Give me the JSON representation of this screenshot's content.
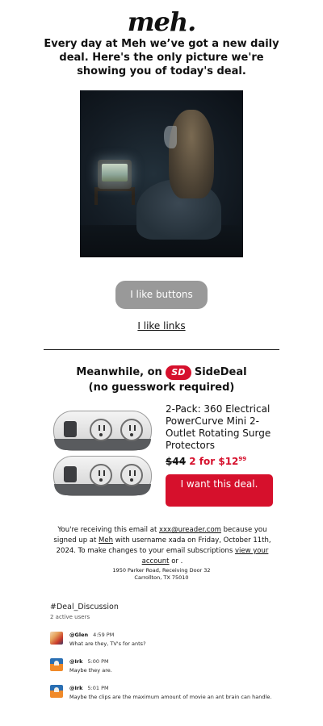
{
  "logo": "meh.",
  "headline": "Every day at Meh we’ve got a new daily deal. Here's the only picture we're showing you of today's deal.",
  "buttons": {
    "i_like_buttons": "I like buttons",
    "i_like_links": "I like links"
  },
  "sidedeal": {
    "line1_prefix": "Meanwhile, on",
    "logo_text": "SD",
    "brand": "SideDeal",
    "line2": "(no guesswork required)",
    "product_title": "2-Pack: 360 Electrical PowerCurve Mini 2-Outlet Rotating Surge Protectors",
    "old_price": "$44",
    "new_price_prefix": "2 for $",
    "new_price_dollars": "12",
    "new_price_cents": "99",
    "cta": "I want this deal."
  },
  "footer": {
    "part1": "You're receiving this email at ",
    "email": "xxx@ureader.com",
    "part2": " because you signed up at ",
    "meh_link": "Meh",
    "part3": " with username xada on Friday, October 11th, 2024. To make changes to your email subscriptions ",
    "account_link": "view your account",
    "part4": " or ."
  },
  "address": {
    "line1": "1950 Parker Road, Receiving Door 32",
    "line2": "Carrollton, TX 75010"
  },
  "discussion": {
    "heading": "#Deal_Discussion",
    "active": "2 active users",
    "comments": [
      {
        "user": "@Glen",
        "time": "4:59 PM",
        "text": "What are they, TV's for ants?"
      },
      {
        "user": "@Irk",
        "time": "5:00 PM",
        "text": "Maybe they are."
      },
      {
        "user": "@Irk",
        "time": "5:01 PM",
        "text": "Maybe the clips are the maximum amount of movie an ant brain can handle."
      }
    ]
  }
}
